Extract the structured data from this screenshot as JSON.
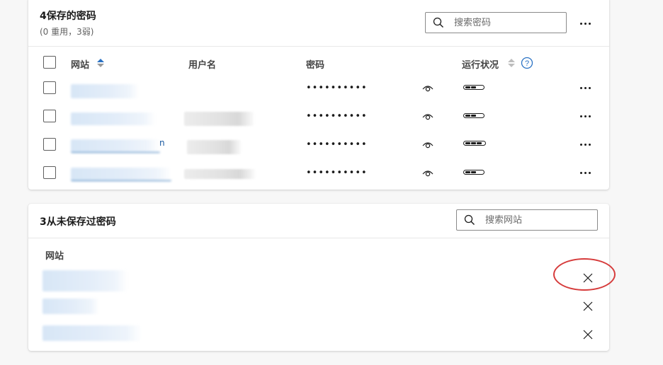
{
  "saved": {
    "title": "4保存的密码",
    "subtitle": "(0 重用，3弱)",
    "search_placeholder": "搜索密码",
    "columns": {
      "site": "网站",
      "username": "用户名",
      "password": "密码",
      "health": "运行状况"
    },
    "rows": [
      {
        "password": "••••••••••",
        "strength_segments": 2,
        "link_fragment": ""
      },
      {
        "password": "••••••••••",
        "strength_segments": 2,
        "link_fragment": ""
      },
      {
        "password": "••••••••••",
        "strength_segments": 3,
        "link_fragment": "n"
      },
      {
        "password": "••••••••••",
        "strength_segments": 2,
        "link_fragment": ""
      }
    ],
    "icons": {
      "search": "search-icon",
      "sort": "sort-icon",
      "help": "help-icon",
      "reveal": "eye-icon",
      "more": "more-icon"
    }
  },
  "never_saved": {
    "title": "3从未保存过密码",
    "search_placeholder": "搜索网站",
    "column": "网站",
    "row_count": 3,
    "icons": {
      "remove": "close-icon"
    }
  },
  "annotation": {
    "color": "#d63b3b"
  }
}
